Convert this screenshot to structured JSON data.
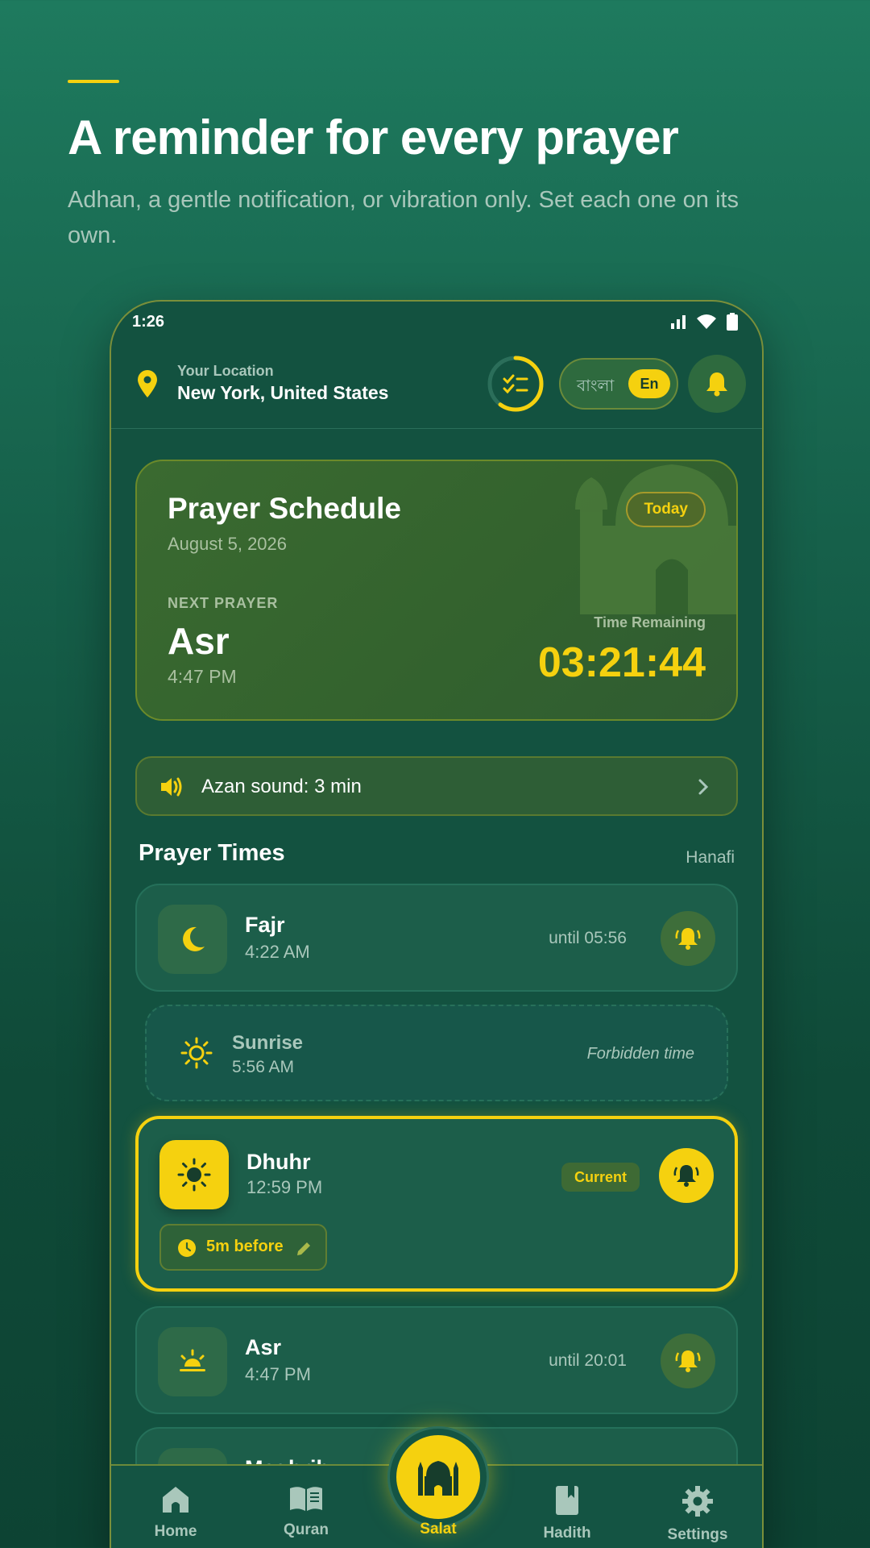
{
  "promo": {
    "headline": "A reminder for every prayer",
    "subline": "Adhan, a gentle notification, or vibration only. Set each one on its own."
  },
  "status": {
    "time": "1:26"
  },
  "header": {
    "location_label": "Your Location",
    "location_value": "New York, United States",
    "lang_bn": "বাংলা",
    "lang_en": "En",
    "progress_fraction": 0.6
  },
  "schedule": {
    "title": "Prayer Schedule",
    "date": "August 5, 2026",
    "badge": "Today",
    "next_label": "NEXT PRAYER",
    "next_name": "Asr",
    "next_time": "4:47 PM",
    "remaining_label": "Time Remaining",
    "remaining_value": "03:21:44"
  },
  "azan": {
    "label": "Azan sound: 3 min"
  },
  "prayer_times": {
    "title": "Prayer Times",
    "madhab": "Hanafi",
    "fajr": {
      "name": "Fajr",
      "time": "4:22 AM",
      "until": "until 05:56"
    },
    "sunrise": {
      "name": "Sunrise",
      "time": "5:56 AM",
      "note": "Forbidden time"
    },
    "dhuhr": {
      "name": "Dhuhr",
      "time": "12:59 PM",
      "badge": "Current",
      "reminder": "5m before"
    },
    "asr": {
      "name": "Asr",
      "time": "4:47 PM",
      "until": "until 20:01"
    },
    "maghrib": {
      "name": "Maghrib"
    }
  },
  "nav": {
    "home": "Home",
    "quran": "Quran",
    "salat": "Salat",
    "hadith": "Hadith",
    "settings": "Settings"
  },
  "colors": {
    "accent": "#f5d10f",
    "bg": "#135240",
    "card": "#1c5e4a"
  }
}
